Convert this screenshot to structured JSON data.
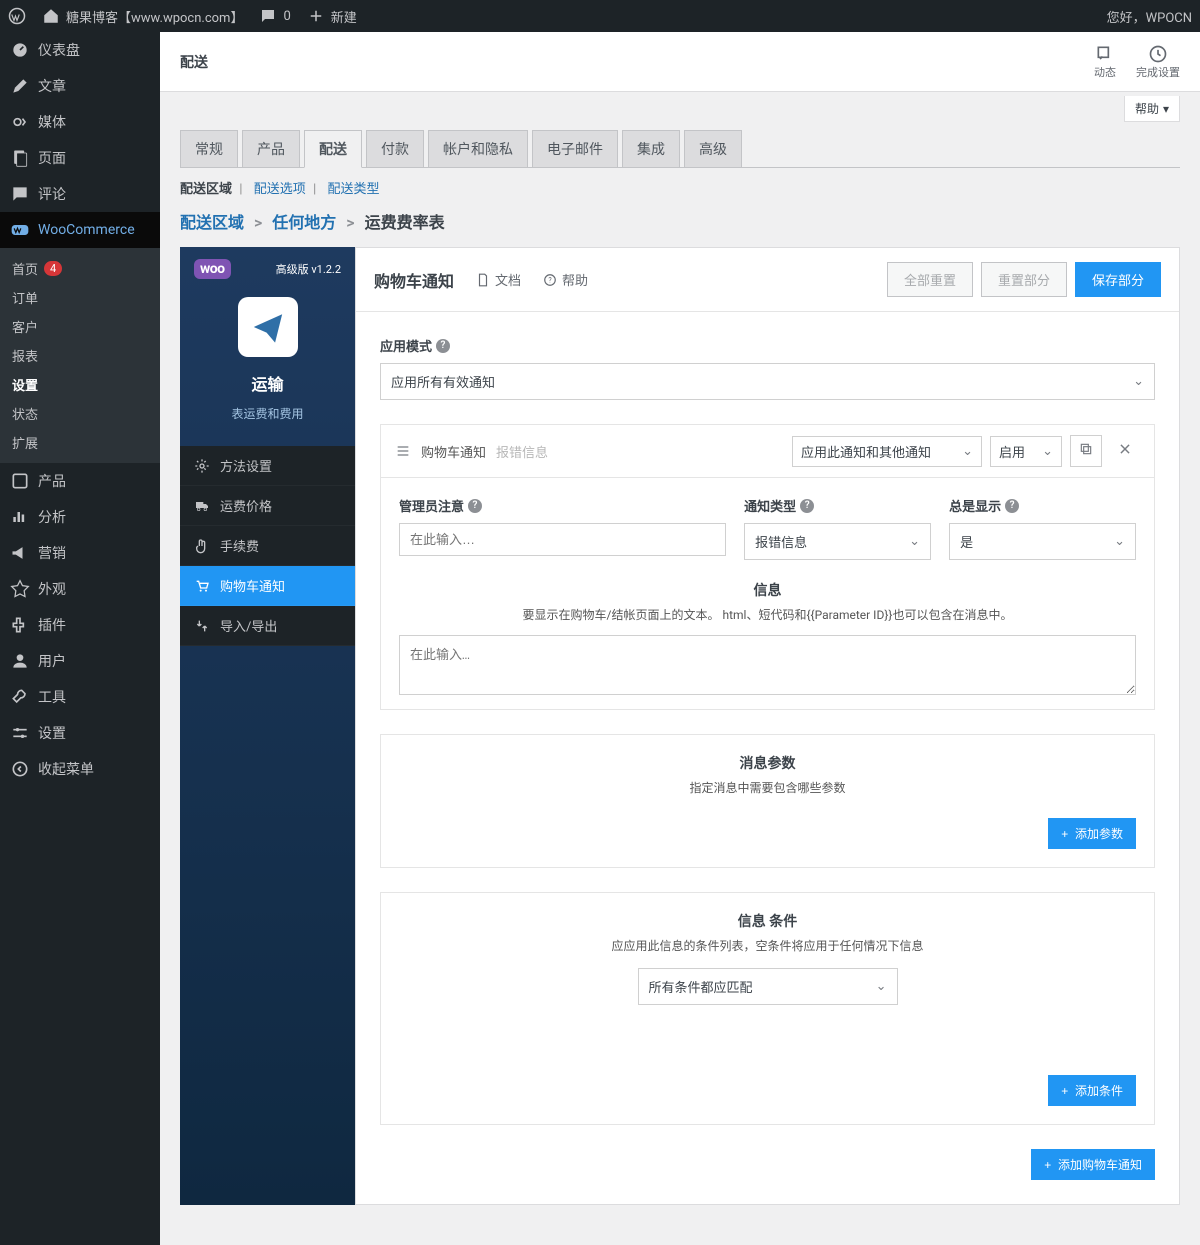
{
  "adminbar": {
    "site_name": "糖果博客【www.wpocn.com】",
    "comments_count": "0",
    "new_label": "新建",
    "greeting": "您好，WPOCN"
  },
  "leftmenu": {
    "dashboard": "仪表盘",
    "posts": "文章",
    "media": "媒体",
    "pages": "页面",
    "comments": "评论",
    "woocommerce": "WooCommerce",
    "woo_sub": {
      "home": "首页",
      "home_badge": "4",
      "orders": "订单",
      "customers": "客户",
      "reports": "报表",
      "settings": "设置",
      "status": "状态",
      "extensions": "扩展"
    },
    "products": "产品",
    "analytics": "分析",
    "marketing": "营销",
    "appearance": "外观",
    "plugins": "插件",
    "users": "用户",
    "tools": "工具",
    "settings": "设置",
    "collapse": "收起菜单"
  },
  "topstrip": {
    "title": "配送",
    "activity": "动态",
    "finish_setup": "完成设置"
  },
  "help_button": "帮助",
  "tabs": [
    "常规",
    "产品",
    "配送",
    "付款",
    "帐户和隐私",
    "电子邮件",
    "集成",
    "高级"
  ],
  "active_tab_index": 2,
  "subtabs": {
    "zones": "配送区域",
    "options": "配送选项",
    "classes": "配送类型"
  },
  "breadcrumb": {
    "zones": "配送区域",
    "anywhere": "任何地方",
    "current": "运费费率表"
  },
  "plugin_side": {
    "version_label": "高级版 v1.2.2",
    "woo_badge": "woo",
    "title": "运输",
    "subtitle": "表运费和费用",
    "nav": {
      "method": "方法设置",
      "rates": "运费价格",
      "fees": "手续费",
      "cart_notice": "购物车通知",
      "import": "导入/导出"
    }
  },
  "content": {
    "header_title": "购物车通知",
    "docs": "文档",
    "help": "帮助",
    "reset_all": "全部重置",
    "reset_section": "重置部分",
    "save_section": "保存部分",
    "mode_label": "应用模式",
    "mode_value": "应用所有有效通知",
    "section_title": "购物车通知",
    "section_subtitle": "报错信息",
    "apply_mode_value": "应用此通知和其他通知",
    "enable_value": "启用",
    "admin_note_label": "管理员注意",
    "admin_note_placeholder": "在此输入…",
    "notice_type_label": "通知类型",
    "notice_type_value": "报错信息",
    "always_show_label": "总是显示",
    "always_show_value": "是",
    "info_title": "信息",
    "info_desc": "要显示在购物车/结帐页面上的文本。 html、短代码和{{Parameter ID}}也可以包含在消息中。",
    "info_placeholder": "在此输入…",
    "params_title": "消息参数",
    "params_desc": "指定消息中需要包含哪些参数",
    "add_param": "添加参数",
    "cond_title": "信息 条件",
    "cond_desc": "应应用此信息的条件列表，空条件将应用于任何情况下信息",
    "cond_match_value": "所有条件都应匹配",
    "add_cond": "添加条件",
    "add_cart_notice": "添加购物车通知"
  }
}
